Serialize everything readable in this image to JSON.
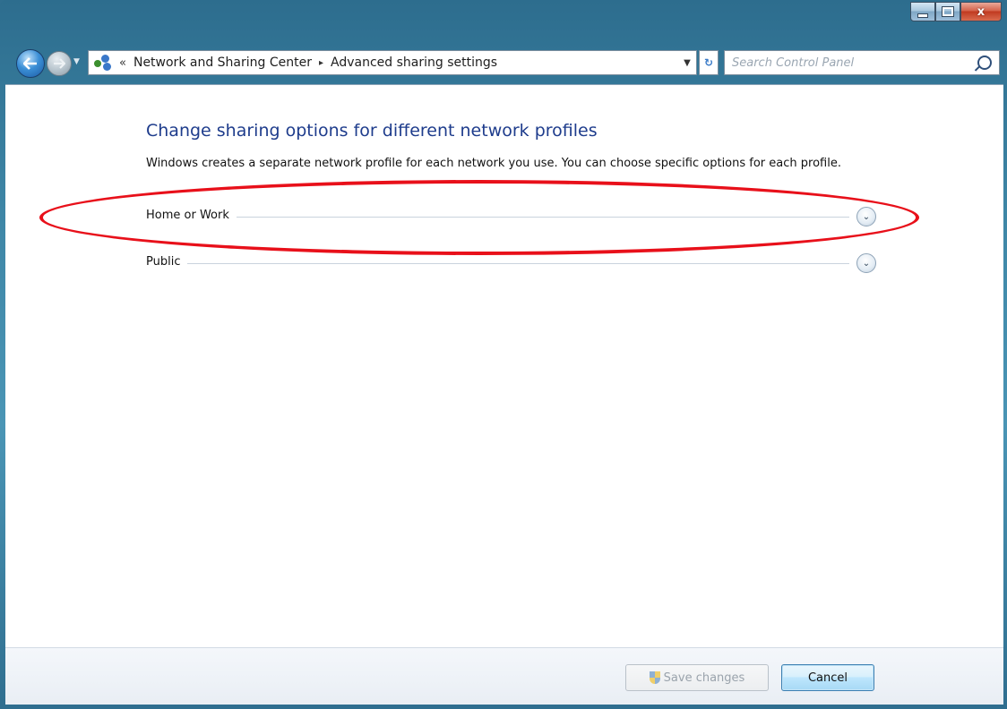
{
  "window": {
    "caption": {
      "minimize": "",
      "maximize": "",
      "close": "x"
    }
  },
  "nav": {
    "breadcrumb_chevron": "«",
    "breadcrumbs": [
      "Network and Sharing Center",
      "Advanced sharing settings"
    ],
    "separator": "▸",
    "search_placeholder": "Search Control Panel"
  },
  "main": {
    "heading": "Change sharing options for different network profiles",
    "description": "Windows creates a separate network profile for each network you use. You can choose specific options for each profile.",
    "profiles": [
      {
        "label": "Home or Work",
        "expanded": false
      },
      {
        "label": "Public",
        "expanded": false
      }
    ]
  },
  "footer": {
    "save_label": "Save changes",
    "save_enabled": false,
    "cancel_label": "Cancel"
  },
  "annotation": {
    "color": "#e8101a",
    "shape": "ellipse"
  },
  "colors": {
    "heading": "#1e3c8c",
    "accent": "#3a7bc8"
  }
}
